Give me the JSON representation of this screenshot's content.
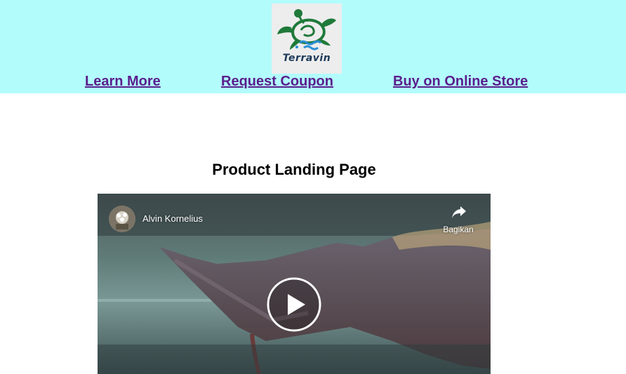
{
  "logo": {
    "text": "Terravin"
  },
  "nav": {
    "learn_more": "Learn More",
    "request_coupon": "Request Coupon",
    "buy_online": "Buy on Online Store"
  },
  "page_title": "Product Landing Page",
  "video": {
    "channel": "Alvin Kornelius",
    "share_label": "Bagikan",
    "icons": [
      "avatar",
      "share-icon",
      "play-icon"
    ]
  },
  "colors": {
    "header_bg": "#b3fcfc",
    "link": "#5a1e8c",
    "logo_turtle": "#1f7a3a",
    "logo_waves": "#2a8fd6"
  }
}
